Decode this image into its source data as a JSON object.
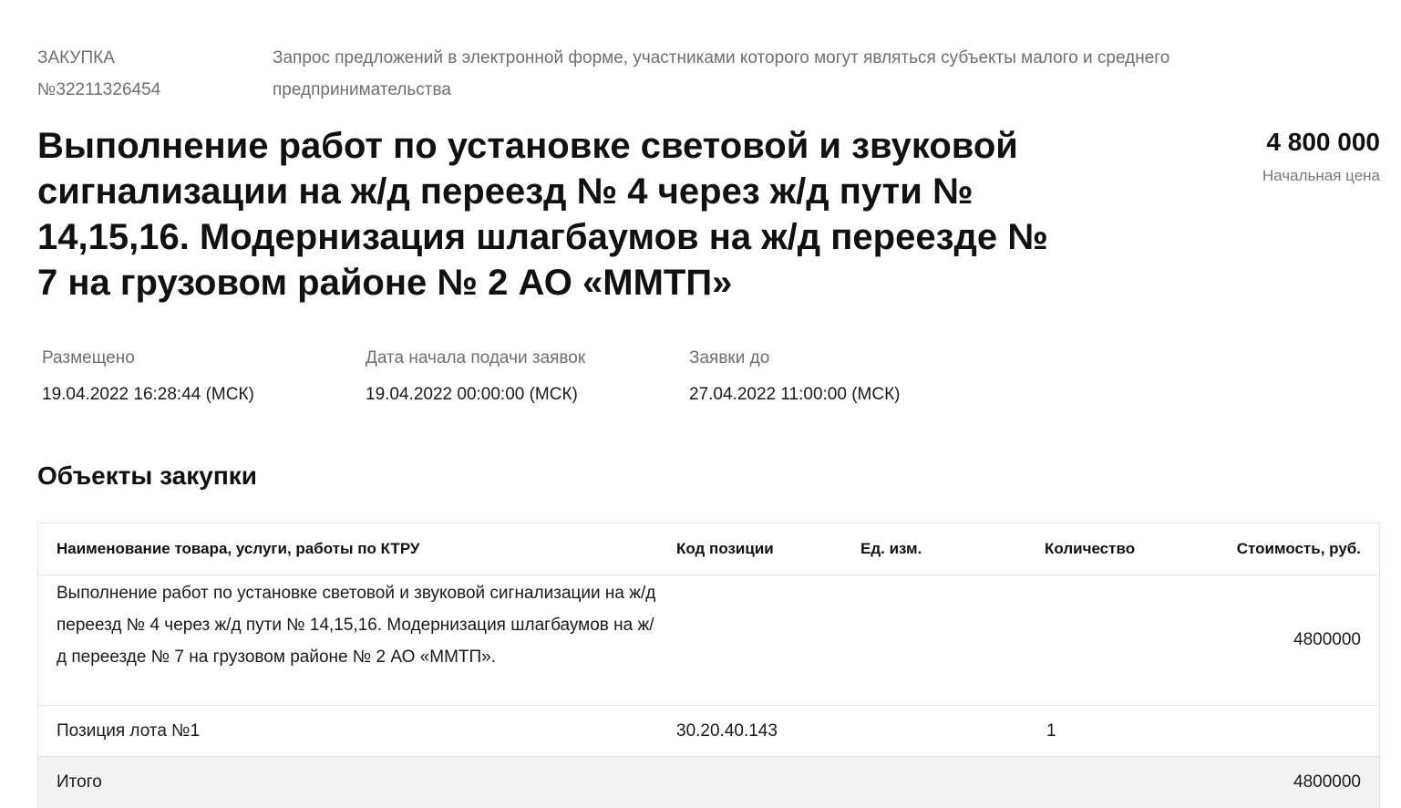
{
  "header": {
    "procurement_label": "ЗАКУПКА",
    "procurement_number": "№32211326454",
    "procurement_type": "Запрос предложений в электронной форме, участниками которого могут являться субъекты малого и среднего предпринимательства"
  },
  "title": "Выполнение работ по установке световой и звуковой сигнализации на ж/д переезд № 4 через ж/д пути № 14,15,16. Модернизация шлагбаумов на ж/д переезде № 7 на грузовом районе № 2 АО «ММТП»",
  "price": {
    "value": "4 800 000",
    "label": "Начальная цена"
  },
  "dates": [
    {
      "label": "Размещено",
      "value": "19.04.2022 16:28:44 (МСК)"
    },
    {
      "label": "Дата начала подачи заявок",
      "value": "19.04.2022 00:00:00 (МСК)"
    },
    {
      "label": "Заявки до",
      "value": "27.04.2022 11:00:00 (МСК)"
    }
  ],
  "objects": {
    "section_title": "Объекты закупки",
    "columns": [
      "Наименование товара, услуги, работы по КТРУ",
      "Код позиции",
      "Ед. изм.",
      "Количество",
      "Стоимость, руб."
    ],
    "rows": [
      {
        "name": "Выполнение работ по установке световой и звуковой сигнализации на ж/д переезд № 4 через ж/д пути № 14,15,16. Модернизация шлагбаумов на ж/д переезде № 7 на грузовом районе № 2 АО «ММТП».",
        "code": "",
        "unit": "",
        "quantity": "",
        "cost": "4800000"
      },
      {
        "name": "Позиция лота №1",
        "code": "30.20.40.143",
        "unit": "",
        "quantity": "1",
        "cost": ""
      }
    ],
    "total": {
      "label": "Итого",
      "cost": "4800000"
    }
  }
}
